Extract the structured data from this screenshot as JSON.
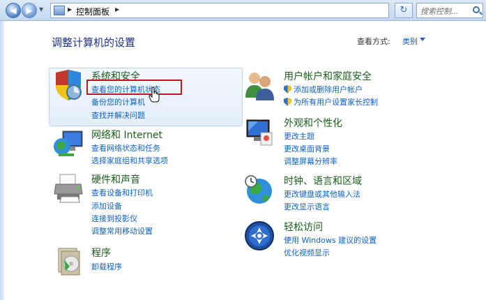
{
  "address_bar": {
    "path": "控制面板",
    "search_placeholder": "搜索控制..."
  },
  "header": {
    "title": "调整计算机的设置",
    "view_by_label": "查看方式:",
    "view_by_value": "类别"
  },
  "categories_left": [
    {
      "title": "系统和安全",
      "icon": "shield-pc-icon",
      "links": [
        "查看您的计算机状态",
        "备份您的计算机",
        "查找并解决问题"
      ]
    },
    {
      "title": "网络和 Internet",
      "icon": "network-globe-icon",
      "links": [
        "查看网络状态和任务",
        "选择家庭组和共享选项"
      ]
    },
    {
      "title": "硬件和声音",
      "icon": "printer-icon",
      "links": [
        "查看设备和打印机",
        "添加设备",
        "连接到投影仪",
        "调整常用移动设置"
      ]
    },
    {
      "title": "程序",
      "icon": "programs-icon",
      "links": [
        "卸载程序"
      ]
    }
  ],
  "categories_right": [
    {
      "title": "用户帐户和家庭安全",
      "icon": "users-icon",
      "links": [
        "添加或删除用户帐户",
        "为所有用户设置家长控制"
      ]
    },
    {
      "title": "外观和个性化",
      "icon": "display-icon",
      "links": [
        "更改主题",
        "更改桌面背景",
        "调整屏幕分辨率"
      ]
    },
    {
      "title": "时钟、语言和区域",
      "icon": "clock-globe-icon",
      "links": [
        "更改键盘或其他输入法",
        "更改显示语言"
      ]
    },
    {
      "title": "轻松访问",
      "icon": "ease-of-access-icon",
      "links": [
        "使用 Windows 建议的设置",
        "优化视频显示"
      ]
    }
  ]
}
